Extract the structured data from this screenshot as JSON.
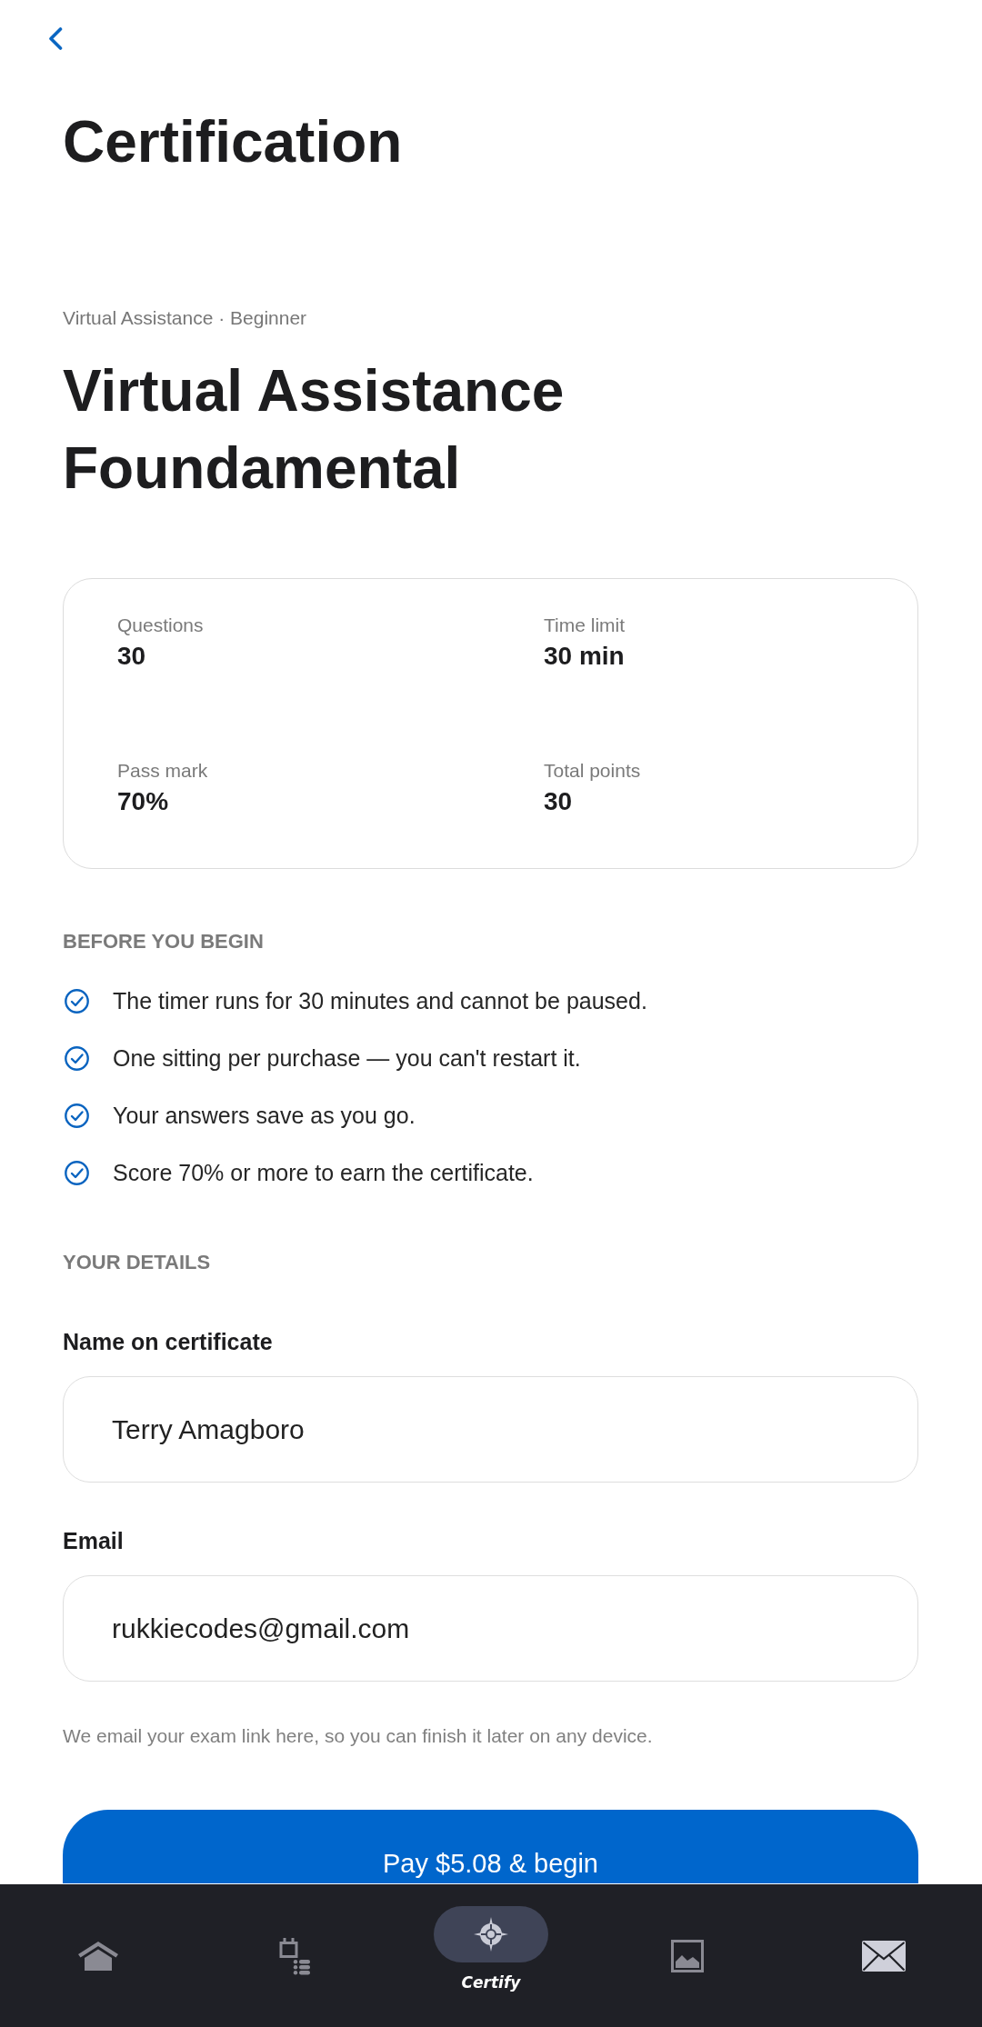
{
  "header": {
    "title": "Certification"
  },
  "course": {
    "breadcrumb": "Virtual Assistance · Beginner",
    "title": "Virtual Assistance Foundamental"
  },
  "stats": [
    {
      "label": "Questions",
      "value": "30"
    },
    {
      "label": "Time limit",
      "value": "30 min"
    },
    {
      "label": "Pass mark",
      "value": "70%"
    },
    {
      "label": "Total points",
      "value": "30"
    }
  ],
  "before_you_begin": {
    "heading": "BEFORE YOU BEGIN",
    "items": [
      "The timer runs for 30 minutes and cannot be paused.",
      "One sitting per purchase — you can't restart it.",
      "Your answers save as you go.",
      "Score 70% or more to earn the certificate."
    ]
  },
  "details": {
    "heading": "YOUR DETAILS",
    "fields": [
      {
        "label": "Name on certificate",
        "value": "Terry Amagboro"
      },
      {
        "label": "Email",
        "value": "rukkiecodes@gmail.com"
      }
    ],
    "note": "We email your exam link here, so you can finish it later on any device."
  },
  "pay_button": {
    "label": "Pay $5.08 & begin"
  },
  "bottom_nav": {
    "items": [
      {
        "selected": false
      },
      {
        "selected": false
      },
      {
        "label": "Certify",
        "selected": true
      },
      {
        "selected": false
      },
      {
        "selected": false
      }
    ]
  }
}
